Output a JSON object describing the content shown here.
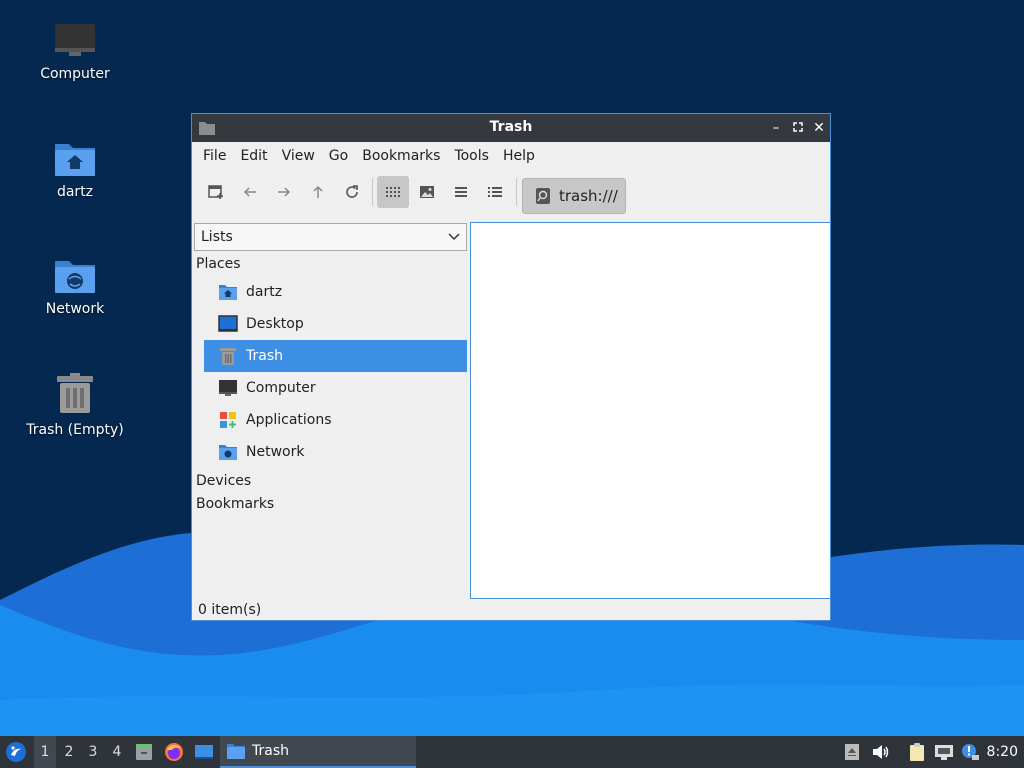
{
  "desktop": {
    "icons": [
      {
        "label": "Computer"
      },
      {
        "label": "dartz"
      },
      {
        "label": "Network"
      },
      {
        "label": "Trash (Empty)"
      }
    ]
  },
  "window": {
    "title": "Trash",
    "menu": [
      "File",
      "Edit",
      "View",
      "Go",
      "Bookmarks",
      "Tools",
      "Help"
    ],
    "path": "trash:///",
    "side_mode": "Lists",
    "groups": {
      "places": "Places",
      "devices": "Devices",
      "bookmarks": "Bookmarks"
    },
    "places": [
      {
        "label": "dartz",
        "icon": "home-folder-icon"
      },
      {
        "label": "Desktop",
        "icon": "desktop-icon"
      },
      {
        "label": "Trash",
        "icon": "trash-icon",
        "selected": true
      },
      {
        "label": "Computer",
        "icon": "computer-icon"
      },
      {
        "label": "Applications",
        "icon": "applications-icon"
      },
      {
        "label": "Network",
        "icon": "network-folder-icon"
      }
    ],
    "status": "0 item(s)"
  },
  "taskbar": {
    "workspaces": [
      "1",
      "2",
      "3",
      "4"
    ],
    "current_workspace": "1",
    "task": "Trash",
    "clock": "8:20"
  },
  "colors": {
    "accent": "#3d8ee5",
    "panel": "#2f343b",
    "titlebar": "#34383f"
  }
}
